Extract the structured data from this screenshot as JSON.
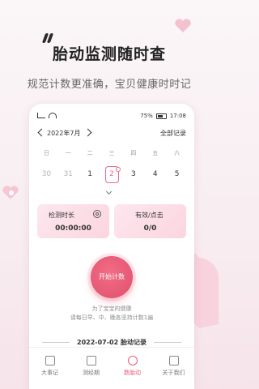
{
  "hero": {
    "title": "胎动监测随时查",
    "subtitle": "规范计数更准确，宝贝健康时时记"
  },
  "status": {
    "battery": "75%",
    "time": "17:08"
  },
  "calendar": {
    "month": "2022年7月",
    "all_records": "全部记录",
    "weekdays": [
      "日",
      "一",
      "二",
      "三",
      "四",
      "五",
      "六"
    ],
    "dates": [
      {
        "n": "30",
        "muted": true
      },
      {
        "n": "31",
        "muted": true
      },
      {
        "n": "1",
        "muted": false
      },
      {
        "n": "2",
        "muted": false,
        "selected": true
      },
      {
        "n": "3",
        "muted": false
      },
      {
        "n": "4",
        "muted": false
      },
      {
        "n": "5",
        "muted": false
      }
    ]
  },
  "cards": {
    "duration_label": "检测时长",
    "duration_value": "00:00:00",
    "valid_label": "有效/点击",
    "valid_value": "0/0"
  },
  "start_button": "开始计数",
  "tips": {
    "line1": "为了宝宝的健康",
    "line2": "请每日早、中、晚各坚持计数1遍"
  },
  "records_title": "2022-07-02 胎动记录",
  "tabs": [
    {
      "label": "大事记",
      "active": false
    },
    {
      "label": "测经期",
      "active": false
    },
    {
      "label": "数胎动",
      "active": true
    },
    {
      "label": "关于我们",
      "active": false
    }
  ],
  "colors": {
    "accent": "#e85b79",
    "card": "#fbd5e0",
    "background": "#f8eef2"
  }
}
